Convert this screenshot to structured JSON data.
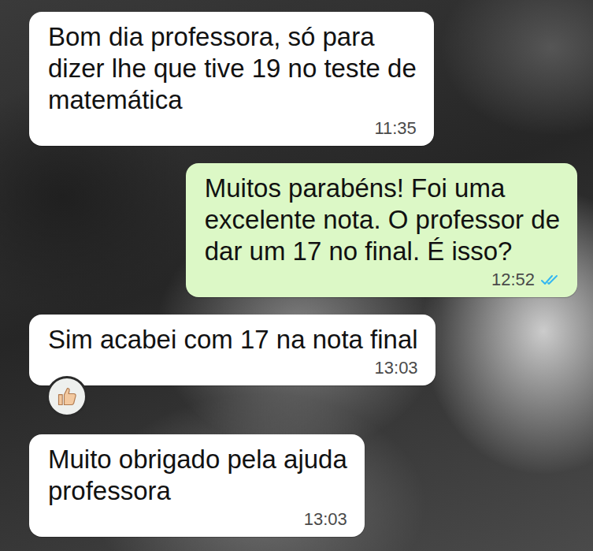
{
  "messages": [
    {
      "kind": "incoming",
      "lines": [
        "Bom dia professora, só para",
        "dizer lhe que tive 19 no teste de",
        "matemática"
      ],
      "time": "11:35",
      "reacted": false
    },
    {
      "kind": "outgoing",
      "lines": [
        "Muitos parabéns! Foi uma",
        "excelente nota. O professor de",
        "dar um 17 no final. É isso?"
      ],
      "time": "12:52",
      "read": true,
      "reacted": false
    },
    {
      "kind": "incoming",
      "lines": [
        "Sim acabei com 17 na nota final"
      ],
      "time": "13:03",
      "reacted": true
    },
    {
      "kind": "incoming",
      "lines": [
        "Muito obrigado pela ajuda",
        "professora"
      ],
      "time": "13:03",
      "reacted": false
    }
  ]
}
